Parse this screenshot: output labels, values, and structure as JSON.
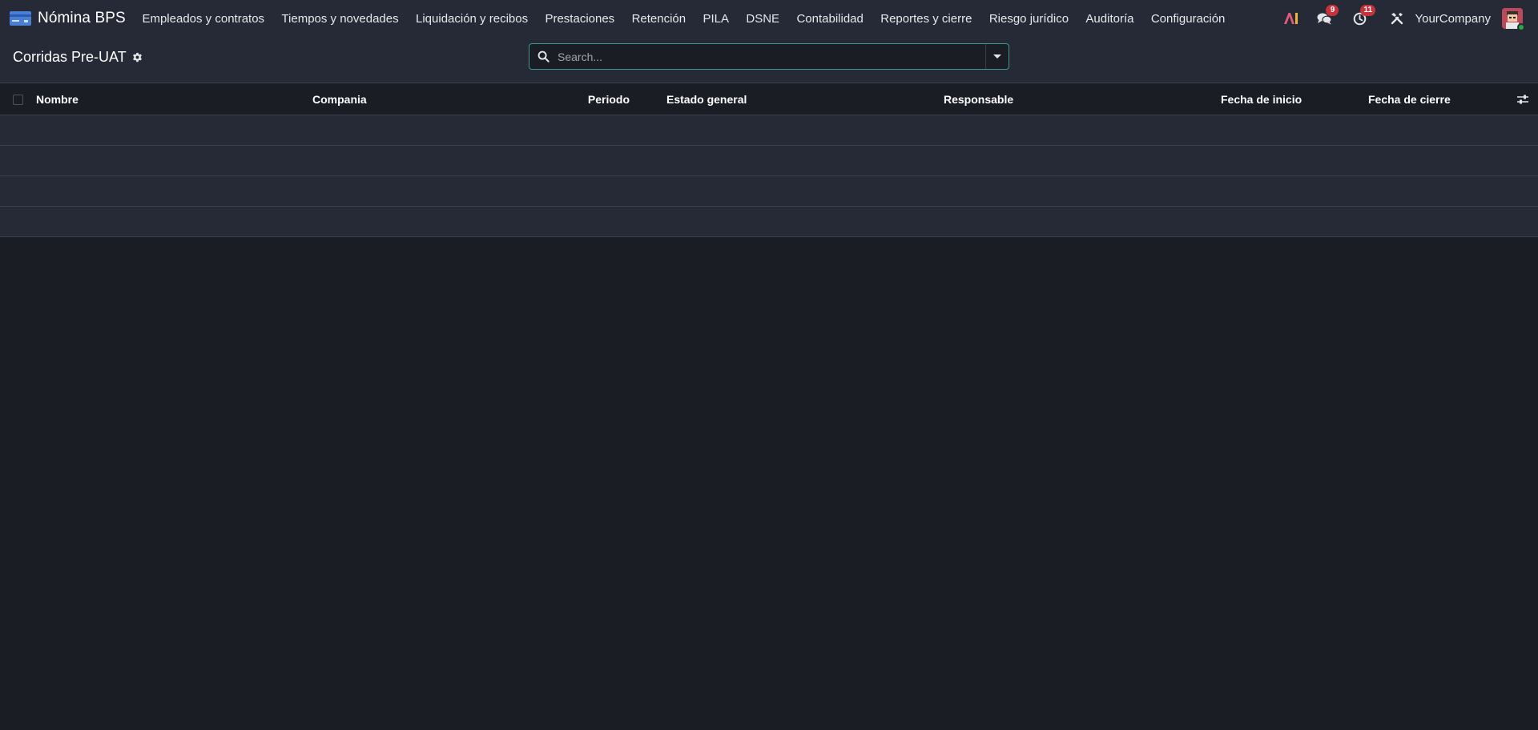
{
  "app": {
    "name": "Nómina BPS"
  },
  "menu": [
    {
      "label": "Empleados y contratos"
    },
    {
      "label": "Tiempos y novedades"
    },
    {
      "label": "Liquidación y recibos"
    },
    {
      "label": "Prestaciones"
    },
    {
      "label": "Retención"
    },
    {
      "label": "PILA"
    },
    {
      "label": "DSNE"
    },
    {
      "label": "Contabilidad"
    },
    {
      "label": "Reportes y cierre"
    },
    {
      "label": "Riesgo jurídico"
    },
    {
      "label": "Auditoría"
    },
    {
      "label": "Configuración"
    }
  ],
  "systray": {
    "ai_label": "AI",
    "messages_count": "9",
    "activities_count": "11",
    "company": "YourCompany"
  },
  "control_panel": {
    "title": "Corridas Pre-UAT",
    "search_placeholder": "Search..."
  },
  "list": {
    "columns": [
      {
        "label": "Nombre"
      },
      {
        "label": "Compania"
      },
      {
        "label": "Periodo"
      },
      {
        "label": "Estado general"
      },
      {
        "label": "Responsable"
      },
      {
        "label": "Fecha de inicio"
      },
      {
        "label": "Fecha de cierre"
      }
    ],
    "rows": []
  },
  "colors": {
    "background": "#1b1d25",
    "navbar": "#262a36",
    "accent": "#3c9a91",
    "badge": "#c7333a",
    "brand_icon": "#4a7fd6"
  },
  "icons": {
    "brand": "credit-card-icon",
    "ai": "ai-icon",
    "messages": "chat-bubbles-icon",
    "activities": "clock-icon",
    "debug": "tools-icon",
    "settings": "gear-icon",
    "search": "magnifier-icon",
    "optional_columns": "sliders-icon"
  }
}
